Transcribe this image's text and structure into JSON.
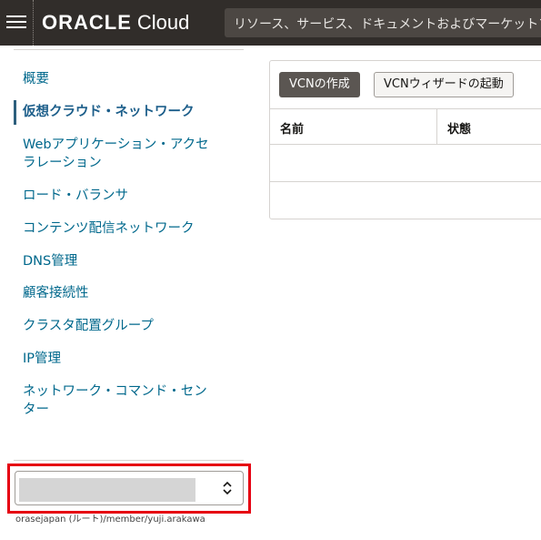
{
  "header": {
    "brand": "ORACLE",
    "product": "Cloud",
    "search_placeholder": "リソース、サービス、ドキュメントおよびマーケットプ"
  },
  "sidebar": {
    "items": [
      {
        "label": "概要",
        "active": false
      },
      {
        "label": "仮想クラウド・ネットワーク",
        "active": true
      },
      {
        "label": "Webアプリケーション・アクセラレーション",
        "active": false
      },
      {
        "label": "ロード・バランサ",
        "active": false
      },
      {
        "label": "コンテンツ配信ネットワーク",
        "active": false
      },
      {
        "label": "DNS管理",
        "active": false
      },
      {
        "label": "顧客接続性",
        "active": false
      },
      {
        "label": "クラスタ配置グループ",
        "active": false
      },
      {
        "label": "IP管理",
        "active": false
      },
      {
        "label": "ネットワーク・コマンド・センター",
        "active": false
      }
    ],
    "compartment": {
      "selected_value": "",
      "path": "orasejapan (ルート)/member/yuji.arakawa"
    }
  },
  "main": {
    "create_vcn_label": "VCNの作成",
    "wizard_label": "VCNウィザードの起動",
    "table": {
      "columns": [
        "名前",
        "状態"
      ],
      "rows": []
    }
  },
  "colors": {
    "header_bg": "#312d2a",
    "link": "#00688c",
    "highlight": "#e60012",
    "primary_button": "#5b5652"
  }
}
